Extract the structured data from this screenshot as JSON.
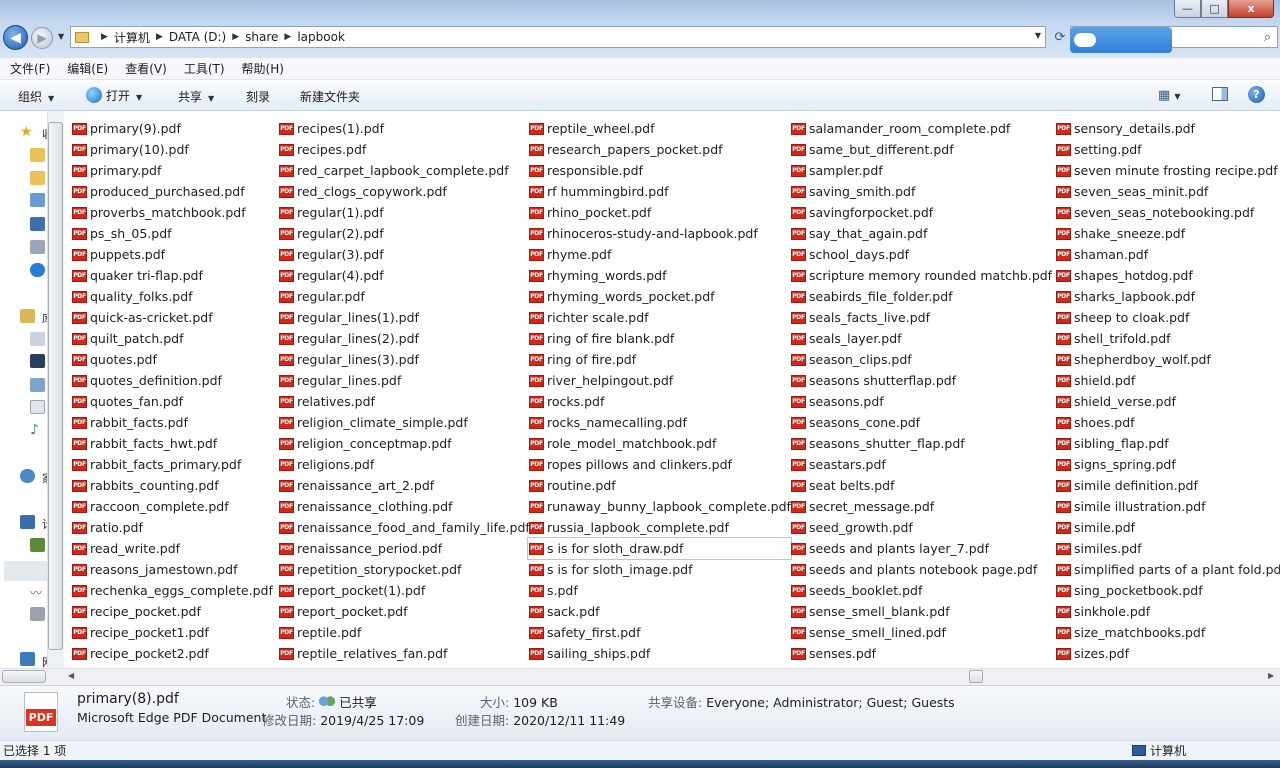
{
  "address": {
    "crumbs": [
      "计算机",
      "DATA (D:)",
      "share",
      "lapbook"
    ]
  },
  "window_controls": {
    "minimize": "—",
    "maximize": "□",
    "close": "x"
  },
  "menu": [
    "文件(F)",
    "编辑(E)",
    "查看(V)",
    "工具(T)",
    "帮助(H)"
  ],
  "toolbar": {
    "organize": "组织",
    "open": "打开",
    "share": "共享",
    "burn": "刻录",
    "new_folder": "新建文件夹"
  },
  "navpane": {
    "labels": [
      "收",
      "库",
      "家",
      "计",
      "网"
    ]
  },
  "icons": {
    "file": "pdf-file-icon",
    "back": "back-arrow-icon",
    "forward": "forward-arrow-icon",
    "refresh": "refresh-icon",
    "search": "search-icon",
    "view": "view-options-icon",
    "preview_pane": "preview-pane-icon",
    "help": "help-icon"
  },
  "files": {
    "col1": [
      "primary(9).pdf",
      "primary(10).pdf",
      "primary.pdf",
      "produced_purchased.pdf",
      "proverbs_matchbook.pdf",
      "ps_sh_05.pdf",
      "puppets.pdf",
      "quaker tri-flap.pdf",
      "quality_folks.pdf",
      "quick-as-cricket.pdf",
      "quilt_patch.pdf",
      "quotes.pdf",
      "quotes_definition.pdf",
      "quotes_fan.pdf",
      "rabbit_facts.pdf",
      "rabbit_facts_hwt.pdf",
      "rabbit_facts_primary.pdf",
      "rabbits_counting.pdf",
      "raccoon_complete.pdf",
      "ratio.pdf",
      "read_write.pdf",
      "reasons_jamestown.pdf",
      "rechenka_eggs_complete.pdf",
      "recipe_pocket.pdf",
      "recipe_pocket1.pdf",
      "recipe_pocket2.pdf"
    ],
    "col2": [
      "recipes(1).pdf",
      "recipes.pdf",
      "red_carpet_lapbook_complete.pdf",
      "red_clogs_copywork.pdf",
      "regular(1).pdf",
      "regular(2).pdf",
      "regular(3).pdf",
      "regular(4).pdf",
      "regular.pdf",
      "regular_lines(1).pdf",
      "regular_lines(2).pdf",
      "regular_lines(3).pdf",
      "regular_lines.pdf",
      "relatives.pdf",
      "religion_climate_simple.pdf",
      "religion_conceptmap.pdf",
      "religions.pdf",
      "renaissance_art_2.pdf",
      "renaissance_clothing.pdf",
      "renaissance_food_and_family_life.pdf",
      "renaissance_period.pdf",
      "repetition_storypocket.pdf",
      "report_pocket(1).pdf",
      "report_pocket.pdf",
      "reptile.pdf",
      "reptile_relatives_fan.pdf"
    ],
    "col3": [
      "reptile_wheel.pdf",
      "research_papers_pocket.pdf",
      "responsible.pdf",
      "rf hummingbird.pdf",
      "rhino_pocket.pdf",
      "rhinoceros-study-and-lapbook.pdf",
      "rhyme.pdf",
      "rhyming_words.pdf",
      "rhyming_words_pocket.pdf",
      "richter scale.pdf",
      "ring of fire blank.pdf",
      "ring of fire.pdf",
      "river_helpingout.pdf",
      "rocks.pdf",
      "rocks_namecalling.pdf",
      "role_model_matchbook.pdf",
      "ropes pillows and clinkers.pdf",
      "routine.pdf",
      "runaway_bunny_lapbook_complete.pdf",
      "russia_lapbook_complete.pdf",
      "s is for sloth_draw.pdf",
      "s is for sloth_image.pdf",
      "s.pdf",
      "sack.pdf",
      "safety_first.pdf",
      "sailing_ships.pdf"
    ],
    "col4": [
      "salamander_room_complete.pdf",
      "same_but_different.pdf",
      "sampler.pdf",
      "saving_smith.pdf",
      "savingforpocket.pdf",
      "say_that_again.pdf",
      "school_days.pdf",
      "scripture memory rounded matchb.pdf",
      "seabirds_file_folder.pdf",
      "seals_facts_live.pdf",
      "seals_layer.pdf",
      "season_clips.pdf",
      "seasons shutterflap.pdf",
      "seasons.pdf",
      "seasons_cone.pdf",
      "seasons_shutter_flap.pdf",
      "seastars.pdf",
      "seat belts.pdf",
      "secret_message.pdf",
      "seed_growth.pdf",
      "seeds and plants layer_7.pdf",
      "seeds and plants notebook page.pdf",
      "seeds_booklet.pdf",
      "sense_smell_blank.pdf",
      "sense_smell_lined.pdf",
      "senses.pdf"
    ],
    "col5": [
      "sensory_details.pdf",
      "setting.pdf",
      "seven minute frosting recipe.pdf",
      "seven_seas_minit.pdf",
      "seven_seas_notebooking.pdf",
      "shake_sneeze.pdf",
      "shaman.pdf",
      "shapes_hotdog.pdf",
      "sharks_lapbook.pdf",
      "sheep to cloak.pdf",
      "shell_trifold.pdf",
      "shepherdboy_wolf.pdf",
      "shield.pdf",
      "shield_verse.pdf",
      "shoes.pdf",
      "sibling_flap.pdf",
      "signs_spring.pdf",
      "simile definition.pdf",
      "simile illustration.pdf",
      "simile.pdf",
      "similes.pdf",
      "simplified parts of a plant fold.pdf",
      "sing_pocketbook.pdf",
      "sinkhole.pdf",
      "size_matchbooks.pdf",
      "sizes.pdf"
    ]
  },
  "details": {
    "filename": "primary(8).pdf",
    "filetype": "Microsoft Edge PDF Document",
    "icon_label": "PDF",
    "state_label": "状态:",
    "state_value": "已共享",
    "modified_label": "修改日期:",
    "modified_value": "2019/4/25 17:09",
    "size_label": "大小:",
    "size_value": "109 KB",
    "created_label": "创建日期:",
    "created_value": "2020/12/11 11:49",
    "shared_label": "共享设备:",
    "shared_value": "Everyone; Administrator; Guest; Guests"
  },
  "status": {
    "selection": "已选择 1 项",
    "location": "计算机"
  },
  "colors": {
    "pdf_icon": "#d0291b",
    "titlebar": "#c5d8ee",
    "close_button": "#c2402a",
    "selection_border": "#b5c9e6"
  }
}
